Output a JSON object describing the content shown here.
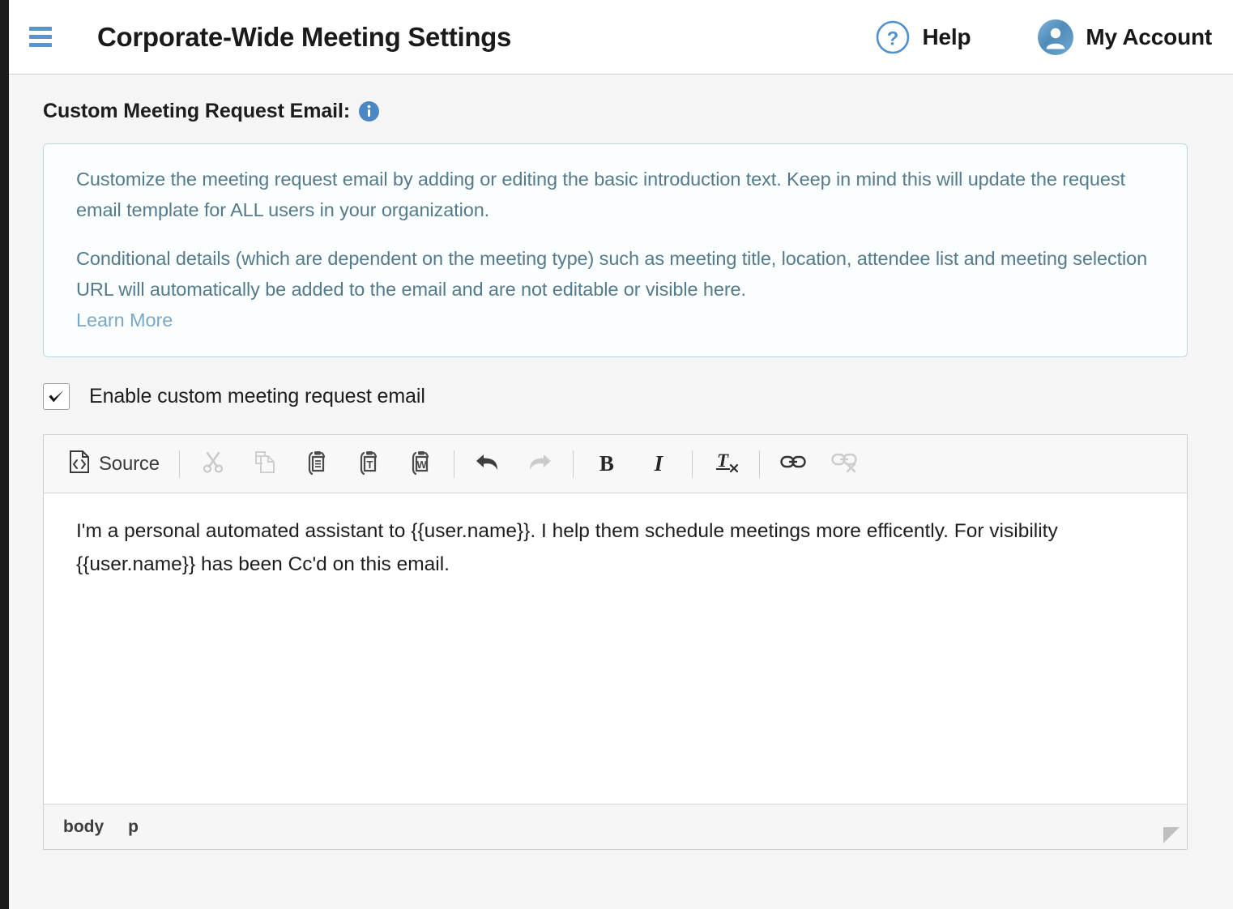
{
  "header": {
    "menu_icon": "hamburger-icon",
    "title": "Corporate-Wide Meeting Settings",
    "help": {
      "icon": "help-circle-icon",
      "label": "Help"
    },
    "account": {
      "icon": "user-avatar-icon",
      "label": "My Account"
    }
  },
  "section": {
    "title": "Custom Meeting Request Email:",
    "info_icon": "info-circle-icon"
  },
  "info_box": {
    "paragraph1": "Customize the meeting request email by adding or editing the basic introduction text. Keep in mind this will update the request email template for ALL users in your organization.",
    "paragraph2": "Conditional details (which are dependent on the meeting type) such as meeting title, location, attendee list and meeting selection URL will automatically be added to the email and are not editable or visible here.",
    "learn_more": "Learn More"
  },
  "enable_checkbox": {
    "label": "Enable custom meeting request email",
    "checked": true,
    "check_glyph": "✔"
  },
  "editor": {
    "toolbar": [
      {
        "name": "source-button",
        "label": "Source",
        "icon": "source-code-icon",
        "enabled": true
      },
      {
        "name": "cut-button",
        "label": "Cut",
        "icon": "scissors-icon",
        "enabled": false
      },
      {
        "name": "copy-button",
        "label": "Copy",
        "icon": "copy-icon",
        "enabled": false
      },
      {
        "name": "paste-button",
        "label": "Paste",
        "icon": "clipboard-icon",
        "enabled": true
      },
      {
        "name": "paste-as-plain-text-button",
        "label": "Paste as plain text",
        "icon": "clipboard-text-icon",
        "enabled": true
      },
      {
        "name": "paste-from-word-button",
        "label": "Paste from Word",
        "icon": "clipboard-word-icon",
        "enabled": true
      },
      {
        "name": "undo-button",
        "label": "Undo",
        "icon": "undo-arrow-icon",
        "enabled": true
      },
      {
        "name": "redo-button",
        "label": "Redo",
        "icon": "redo-arrow-icon",
        "enabled": false
      },
      {
        "name": "bold-button",
        "label": "B",
        "icon": "bold-icon",
        "enabled": true
      },
      {
        "name": "italic-button",
        "label": "I",
        "icon": "italic-icon",
        "enabled": true
      },
      {
        "name": "remove-format-button",
        "label": "Remove Format",
        "icon": "remove-format-icon",
        "enabled": true
      },
      {
        "name": "link-button",
        "label": "Link",
        "icon": "link-icon",
        "enabled": true
      },
      {
        "name": "unlink-button",
        "label": "Unlink",
        "icon": "unlink-icon",
        "enabled": false
      }
    ],
    "source_label": "Source",
    "bold_label": "B",
    "italic_label": "I",
    "body_text": "I'm a personal automated assistant to {{user.name}}. I help them schedule meetings more efficently. For visibility {{user.name}} has been Cc'd on this email.",
    "status_path": [
      "body",
      "p"
    ],
    "resize_grip": "resize-handle-icon"
  },
  "colors": {
    "accent_blue": "#5b93ce",
    "info_text": "#557a8a",
    "info_border": "#bdd6de",
    "info_bg": "#fbfefe",
    "link_blue": "#7aa7c7",
    "page_bg": "#f5f5f5",
    "rail_dark": "#1c1c1c"
  }
}
